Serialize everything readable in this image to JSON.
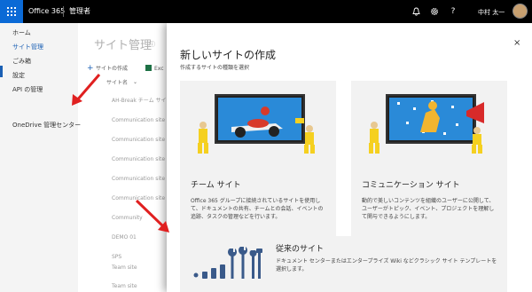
{
  "topbar": {
    "app_name": "Office 365",
    "admin_label": "管理者",
    "user_name": "中村 太一",
    "help_glyph": "?",
    "icons": [
      "app-launcher-icon",
      "bell-icon",
      "gear-icon",
      "help-icon",
      "avatar"
    ]
  },
  "leftnav": {
    "items": [
      "ホーム",
      "サイト管理",
      "ごみ箱",
      "設定",
      "API の管理"
    ],
    "onedrive": "OneDrive 管理センター",
    "accent": "#1a5fb4"
  },
  "background": {
    "page_title": "サイト管理",
    "create_site": "サイトの作成",
    "export": "Exc",
    "column_site_name": "サイト名",
    "rows": [
      "AH-Break チーム サイト",
      "Communication site",
      "Communication site",
      "Communication site",
      "Communication site",
      "Communication site",
      "Community",
      "DEMO 01",
      "SPS",
      "Team site",
      "Team site"
    ]
  },
  "panel": {
    "title": "新しいサイトの作成",
    "subtitle": "作成するサイトの種類を選択",
    "close_glyph": "×",
    "cards": {
      "team": {
        "title": "チーム サイト",
        "description": "Office 365 グループに接続されているサイトを使用して、ドキュメントの共有、チームとの会話、イベントの追跡、タスクの管理などを行います。"
      },
      "communication": {
        "title": "コミュニケーション サイト",
        "description": "動的で美しいコンテンツを組織のユーザーに公開して、ユーザーがトピック、イベント、プロジェクトを理解して関与できるようにします。"
      },
      "classic": {
        "title": "従来のサイト",
        "description": "ドキュメント センターまたはエンタープライズ Wiki などクラシック サイト テンプレートを選択します。"
      }
    }
  },
  "colors": {
    "topbar": "#000000",
    "waffle": "#0b6ad6",
    "annotation_arrow": "#e02020",
    "card_bg": "#f2f2f2"
  }
}
